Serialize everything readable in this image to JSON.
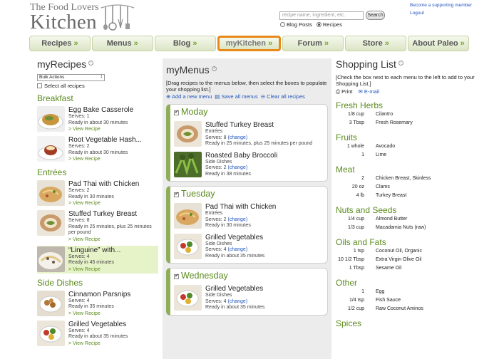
{
  "header": {
    "logo_small": "The Food Lovers",
    "logo_big": "Kitchen",
    "search_placeholder": "recipe name, ingredient, etc.",
    "search_button": "Search",
    "radio_blog": "Blog Posts",
    "radio_recipes": "Recipes",
    "link_support": "Become a supporting member",
    "link_logout": "Logout"
  },
  "nav": [
    {
      "label": "Recipes",
      "raquo": "»"
    },
    {
      "label": "Menus",
      "raquo": "»"
    },
    {
      "label": "Blog",
      "raquo": "»"
    },
    {
      "label": "myKitchen",
      "raquo": "»"
    },
    {
      "label": "Forum",
      "raquo": "»"
    },
    {
      "label": "Store",
      "raquo": "»"
    },
    {
      "label": "About Paleo",
      "raquo": "»"
    }
  ],
  "left": {
    "title": "myRecipes",
    "info": "i",
    "bulk_actions": "Bulk Actions",
    "select_all": "Select all recipes",
    "categories": [
      {
        "name": "Breakfast",
        "recipes": [
          {
            "title": "Egg Bake Casserole",
            "serves": "Serves: 1",
            "ready": "Ready in about 30 minutes",
            "link": "> View Recipe"
          },
          {
            "title": "Root Vegetable Hash...",
            "serves": "Serves: 2",
            "ready": "Ready in about 30 minutes",
            "link": "> View Recipe"
          }
        ]
      },
      {
        "name": "Entrées",
        "recipes": [
          {
            "title": "Pad Thai with Chicken",
            "serves": "Serves: 2",
            "ready": "Ready in 30 minutes",
            "link": "> View Recipe"
          },
          {
            "title": "Stuffed Turkey Breast",
            "serves": "Serves: 8",
            "ready": "Ready in 25 minutes, plus 25 minutes per pound",
            "link": "> View Recipe"
          },
          {
            "title": "“Linguine” with...",
            "serves": "Serves: 4",
            "ready": "Ready in 45 minutes",
            "link": "> View Recipe"
          }
        ]
      },
      {
        "name": "Side Dishes",
        "recipes": [
          {
            "title": "Cinnamon Parsnips",
            "serves": "Serves: 4",
            "ready": "Ready in 35 minutes",
            "link": "> View Recipe"
          },
          {
            "title": "Grilled Vegetables",
            "serves": "Serves: 4",
            "ready": "Ready in about 35 minutes",
            "link": "> View Recipe"
          }
        ]
      }
    ]
  },
  "mid": {
    "title": "myMenus",
    "info": "i",
    "instructions": "[Drag recipes to the menus below, then select the boxes to populate your shopping list.]",
    "add_menu": "Add a new menu",
    "save_menus": "Save all menus",
    "clear_recipes": "Clear all recipes",
    "days": [
      {
        "name": "Moday",
        "recipes": [
          {
            "title": "Stuffed Turkey Breast",
            "type": "Entrées",
            "serves": "Serves: 8",
            "change": "(change)",
            "ready": "Ready in 25 minutes, plus 25 minutes per pound"
          },
          {
            "title": "Roasted Baby Broccoli",
            "type": "Side Dishes",
            "serves": "Serves: 2",
            "change": "(change)",
            "ready": "Ready in 38 minutes"
          }
        ]
      },
      {
        "name": "Tuesday",
        "recipes": [
          {
            "title": "Pad Thai with Chicken",
            "type": "Entrées",
            "serves": "Serves: 2",
            "change": "(change)",
            "ready": "Ready in 30 minutes"
          },
          {
            "title": "Grilled Vegetables",
            "type": "Side Dishes",
            "serves": "Serves: 4",
            "change": "(change)",
            "ready": "Ready in about 35 minutes"
          }
        ]
      },
      {
        "name": "Wednesday",
        "recipes": [
          {
            "title": "Grilled Vegetables",
            "type": "Side Dishes",
            "serves": "Serves: 4",
            "change": "(change)",
            "ready": "Ready in about 35 minutes"
          }
        ]
      }
    ]
  },
  "right": {
    "title": "Shopping List",
    "info": "i",
    "instructions": "[Check the box next to each menu to the left to add to your Shopping List.]",
    "print": "Print",
    "email": "E-mail",
    "categories": [
      {
        "name": "Fresh Herbs",
        "items": [
          {
            "qty": "1/8 cup",
            "item": "Cilantro"
          },
          {
            "qty": "3 Tbsp",
            "item": "Fresh Rosemary"
          }
        ]
      },
      {
        "name": "Fruits",
        "items": [
          {
            "qty": "1 whole",
            "item": "Avocado"
          },
          {
            "qty": "1",
            "item": "Lime"
          }
        ]
      },
      {
        "name": "Meat",
        "items": [
          {
            "qty": "2",
            "item": "Chicken Breast, Skinless"
          },
          {
            "qty": "20 oz",
            "item": "Clams"
          },
          {
            "qty": "4 lb",
            "item": "Turkey Breast"
          }
        ]
      },
      {
        "name": "Nuts and Seeds",
        "items": [
          {
            "qty": "1/4 cup",
            "item": "Almond Butter"
          },
          {
            "qty": "1/3 cup",
            "item": "Macadamia Nuts (raw)"
          }
        ]
      },
      {
        "name": "Oils and Fats",
        "items": [
          {
            "qty": "1 tsp",
            "item": "Coconut Oil, Organic"
          },
          {
            "qty": "10 1/2 Tbsp",
            "item": "Extra Virgin Olive Oil"
          },
          {
            "qty": "1 Tbsp",
            "item": "Sesame Oil"
          }
        ]
      },
      {
        "name": "Other",
        "items": [
          {
            "qty": "1",
            "item": "Egg"
          },
          {
            "qty": "1/4 tsp",
            "item": "Fish Sauce"
          },
          {
            "qty": "1/2 cup",
            "item": "Raw Coconut Aminos"
          }
        ]
      },
      {
        "name": "Spices",
        "items": []
      }
    ]
  },
  "colors": {
    "accent_green": "#5b8a1e",
    "nav_active_border": "#e78a19",
    "link_blue": "#2255bb"
  }
}
